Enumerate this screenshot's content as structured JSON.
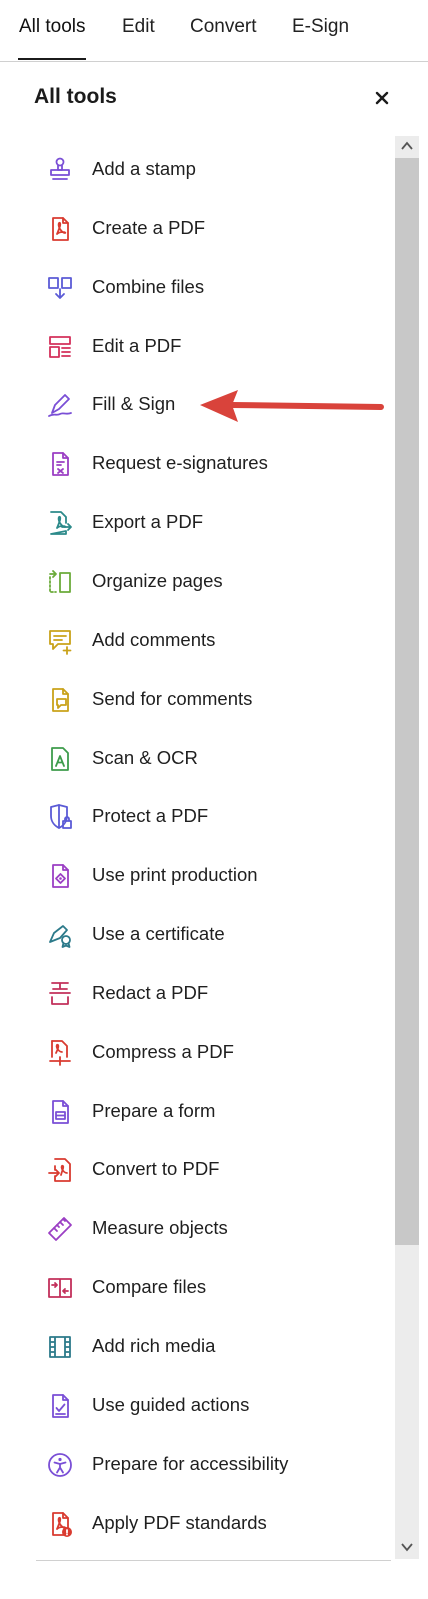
{
  "tabs": [
    {
      "label": "All tools",
      "active": true
    },
    {
      "label": "Edit"
    },
    {
      "label": "Convert"
    },
    {
      "label": "E-Sign"
    }
  ],
  "panel": {
    "title": "All tools",
    "close_icon": "close-icon"
  },
  "tools": [
    {
      "label": "Add a stamp",
      "icon": "stamp-icon",
      "color": "#7a4fd6"
    },
    {
      "label": "Create a PDF",
      "icon": "create-pdf-icon",
      "color": "#d93b30"
    },
    {
      "label": "Combine files",
      "icon": "combine-files-icon",
      "color": "#5b5bd6"
    },
    {
      "label": "Edit a PDF",
      "icon": "edit-pdf-icon",
      "color": "#d4305b"
    },
    {
      "label": "Fill & Sign",
      "icon": "fill-sign-icon",
      "color": "#7a4fd6"
    },
    {
      "label": "Request e-signatures",
      "icon": "request-esign-icon",
      "color": "#9b3fc4"
    },
    {
      "label": "Export a PDF",
      "icon": "export-pdf-icon",
      "color": "#2c8a8a"
    },
    {
      "label": "Organize pages",
      "icon": "organize-pages-icon",
      "color": "#6bab3a"
    },
    {
      "label": "Add comments",
      "icon": "add-comments-icon",
      "color": "#c9a21a"
    },
    {
      "label": "Send for comments",
      "icon": "send-comments-icon",
      "color": "#c9a21a"
    },
    {
      "label": "Scan & OCR",
      "icon": "scan-ocr-icon",
      "color": "#3e9c4c"
    },
    {
      "label": "Protect a PDF",
      "icon": "protect-pdf-icon",
      "color": "#5b5bd6"
    },
    {
      "label": "Use print production",
      "icon": "print-production-icon",
      "color": "#9b3fc4"
    },
    {
      "label": "Use a certificate",
      "icon": "certificate-icon",
      "color": "#2c7a8a"
    },
    {
      "label": "Redact a PDF",
      "icon": "redact-pdf-icon",
      "color": "#c2305b"
    },
    {
      "label": "Compress a PDF",
      "icon": "compress-pdf-icon",
      "color": "#d93b30"
    },
    {
      "label": "Prepare a form",
      "icon": "prepare-form-icon",
      "color": "#7a4fd6"
    },
    {
      "label": "Convert to PDF",
      "icon": "convert-to-pdf-icon",
      "color": "#d93b30"
    },
    {
      "label": "Measure objects",
      "icon": "measure-icon",
      "color": "#9b3fc4"
    },
    {
      "label": "Compare files",
      "icon": "compare-files-icon",
      "color": "#c2305b"
    },
    {
      "label": "Add rich media",
      "icon": "rich-media-icon",
      "color": "#2c7a8a"
    },
    {
      "label": "Use guided actions",
      "icon": "guided-actions-icon",
      "color": "#7a4fd6"
    },
    {
      "label": "Prepare for accessibility",
      "icon": "accessibility-icon",
      "color": "#7a4fd6"
    },
    {
      "label": "Apply PDF standards",
      "icon": "pdf-standards-icon",
      "color": "#d93b30"
    }
  ],
  "annotation": {
    "arrow_color": "#d9433b",
    "arrow_icon": "arrow-left-icon"
  }
}
